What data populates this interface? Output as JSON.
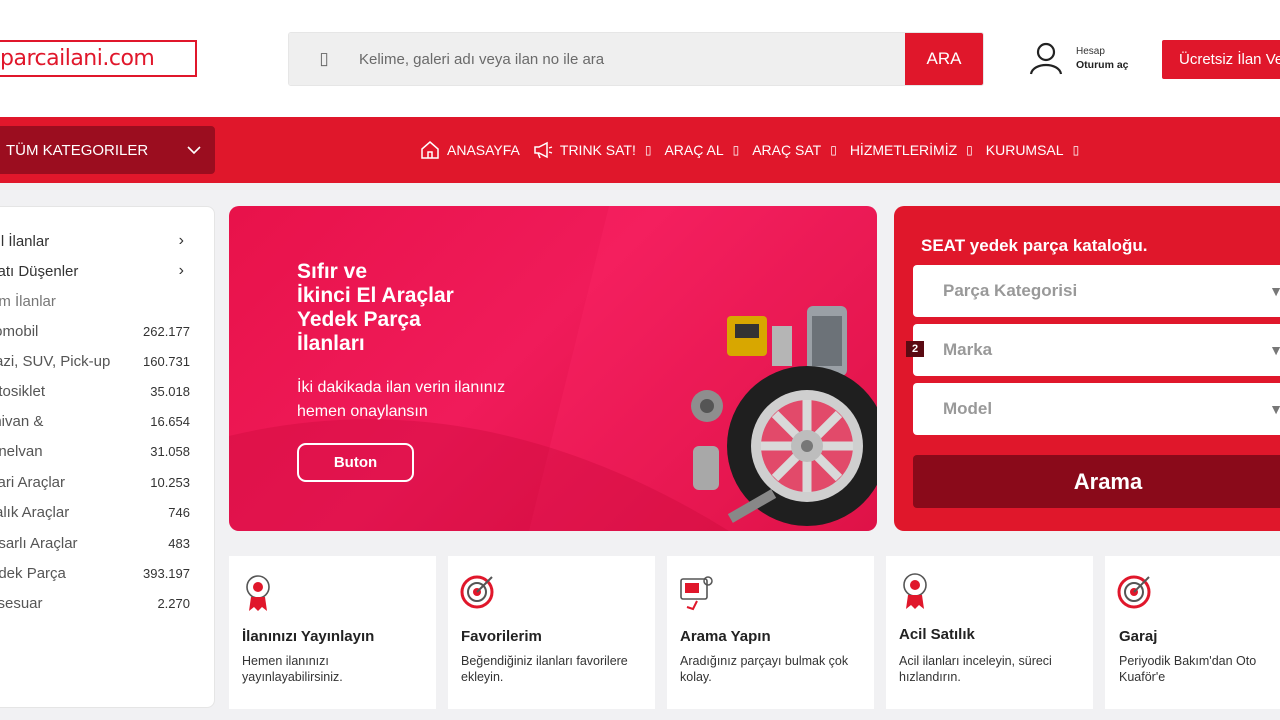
{
  "header": {
    "logo_text_a": "parca",
    "logo_text_b": "ilani",
    "logo_text_c": ".com",
    "search": {
      "placeholder": "Kelime, galeri adı veya ilan no ile ara",
      "button": "ARA",
      "icon": "phone-icon"
    },
    "account": {
      "line1": "Hesap",
      "line2": "Oturum aç",
      "icon": "user-icon"
    },
    "cta": "Ücretsiz İlan Ver"
  },
  "nav": {
    "categories_button": "TÜM KATEGORILER",
    "items": [
      {
        "label": "ANASAYFA",
        "icon": "home-icon"
      },
      {
        "label": "TRINK SAT!",
        "icon": "megaphone-icon"
      },
      {
        "label": "ARAÇ AL"
      },
      {
        "label": "ARAÇ SAT"
      },
      {
        "label": "HİZMETLERİMİZ"
      },
      {
        "label": "KURUMSAL"
      }
    ]
  },
  "sidebar": {
    "items": [
      {
        "label": "cil İlanlar",
        "count": ""
      },
      {
        "label": "yatı Düşenler",
        "count": ""
      },
      {
        "label": "üm İlanlar",
        "count": ""
      },
      {
        "label": "tomobil",
        "count": "262.177"
      },
      {
        "label": "razi, SUV, Pick-up",
        "count": "160.731"
      },
      {
        "label": "otosiklet",
        "count": "35.018"
      },
      {
        "label": "inivan &",
        "count": "16.654"
      },
      {
        "label": "anelvan",
        "count": "31.058"
      },
      {
        "label": "cari Araçlar",
        "count": "10.253"
      },
      {
        "label": "ralık Araçlar",
        "count": "746"
      },
      {
        "label": "asarlı Araçlar",
        "count": "483"
      },
      {
        "label": "edek Parça",
        "count": "393.197"
      },
      {
        "label": "ksesuar",
        "count": "2.270"
      }
    ]
  },
  "banner": {
    "title_lines": [
      "Sıfır ve",
      "İkinci El Araçlar",
      "Yedek Parça",
      "İlanları"
    ],
    "subtitle": "İki dakikada ilan verin ilanınız hemen onaylansın",
    "button": "Buton"
  },
  "catalog": {
    "heading": "SEAT yedek parça kataloğu.",
    "selects": [
      "Parça Kategorisi",
      "Marka",
      "Model"
    ],
    "badge": "2",
    "button": "Arama"
  },
  "features": [
    {
      "title": "İlanınızı Yayınlayın",
      "desc": "Hemen ilanınızı yayınlayabilirsiniz.",
      "icon": "badge-icon"
    },
    {
      "title": "Favorilerim",
      "desc": "Beğendiğiniz ilanları favorilere ekleyin.",
      "icon": "target-icon"
    },
    {
      "title": "Arama Yapın",
      "desc": "Aradığınız parçayı bulmak çok kolay.",
      "icon": "search-card-icon"
    },
    {
      "title": "Acil Satılık",
      "desc": "Acil ilanları inceleyin, süreci hızlandırın.",
      "icon": "badge-icon"
    },
    {
      "title": "Garaj",
      "desc": "Periyodik Bakım'dan Oto Kuaför'e",
      "icon": "target-icon"
    }
  ],
  "colors": {
    "brand": "#e0172b",
    "dark": "#9b0d1f"
  }
}
